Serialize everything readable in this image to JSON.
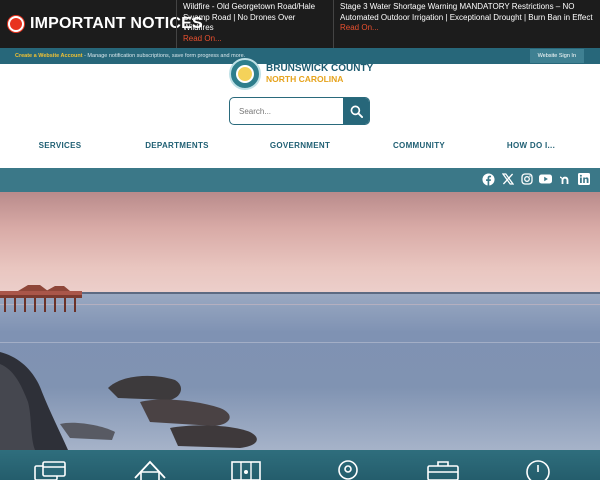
{
  "notices": {
    "title": "IMPORTANT NOTICES",
    "items": [
      {
        "text": "Wildfire - Old Georgetown Road/Hale Swamp Road | No Drones Over Wildfires",
        "link": "Read On..."
      },
      {
        "text": "Stage 3 Water Shortage Warning MANDATORY Restrictions – NO Automated Outdoor Irrigation | Exceptional Drought | Burn Ban in Effect",
        "link": "Read On..."
      }
    ]
  },
  "account": {
    "link": "Create a Website Account",
    "text": " - Manage notification subscriptions, save form progress and more.",
    "signin": "Website Sign In"
  },
  "logo": {
    "name": "BRUNSWICK COUNTY",
    "state": "NORTH CAROLINA"
  },
  "search": {
    "placeholder": "Search..."
  },
  "nav": {
    "services": "SERVICES",
    "departments": "DEPARTMENTS",
    "government": "GOVERNMENT",
    "community": "COMMUNITY",
    "howdoi": "HOW DO I..."
  },
  "social": [
    "facebook-icon",
    "x-icon",
    "instagram-icon",
    "youtube-icon",
    "nextdoor-icon",
    "linkedin-icon"
  ],
  "quick_links": [
    "payments-icon",
    "home-icon",
    "map-icon",
    "location-pin-icon",
    "briefcase-icon",
    "clock-icon"
  ],
  "colors": {
    "teal": "#27677a",
    "alert_red": "#e8331f",
    "gold": "#e6a31c",
    "dark": "#1c1c1c"
  }
}
